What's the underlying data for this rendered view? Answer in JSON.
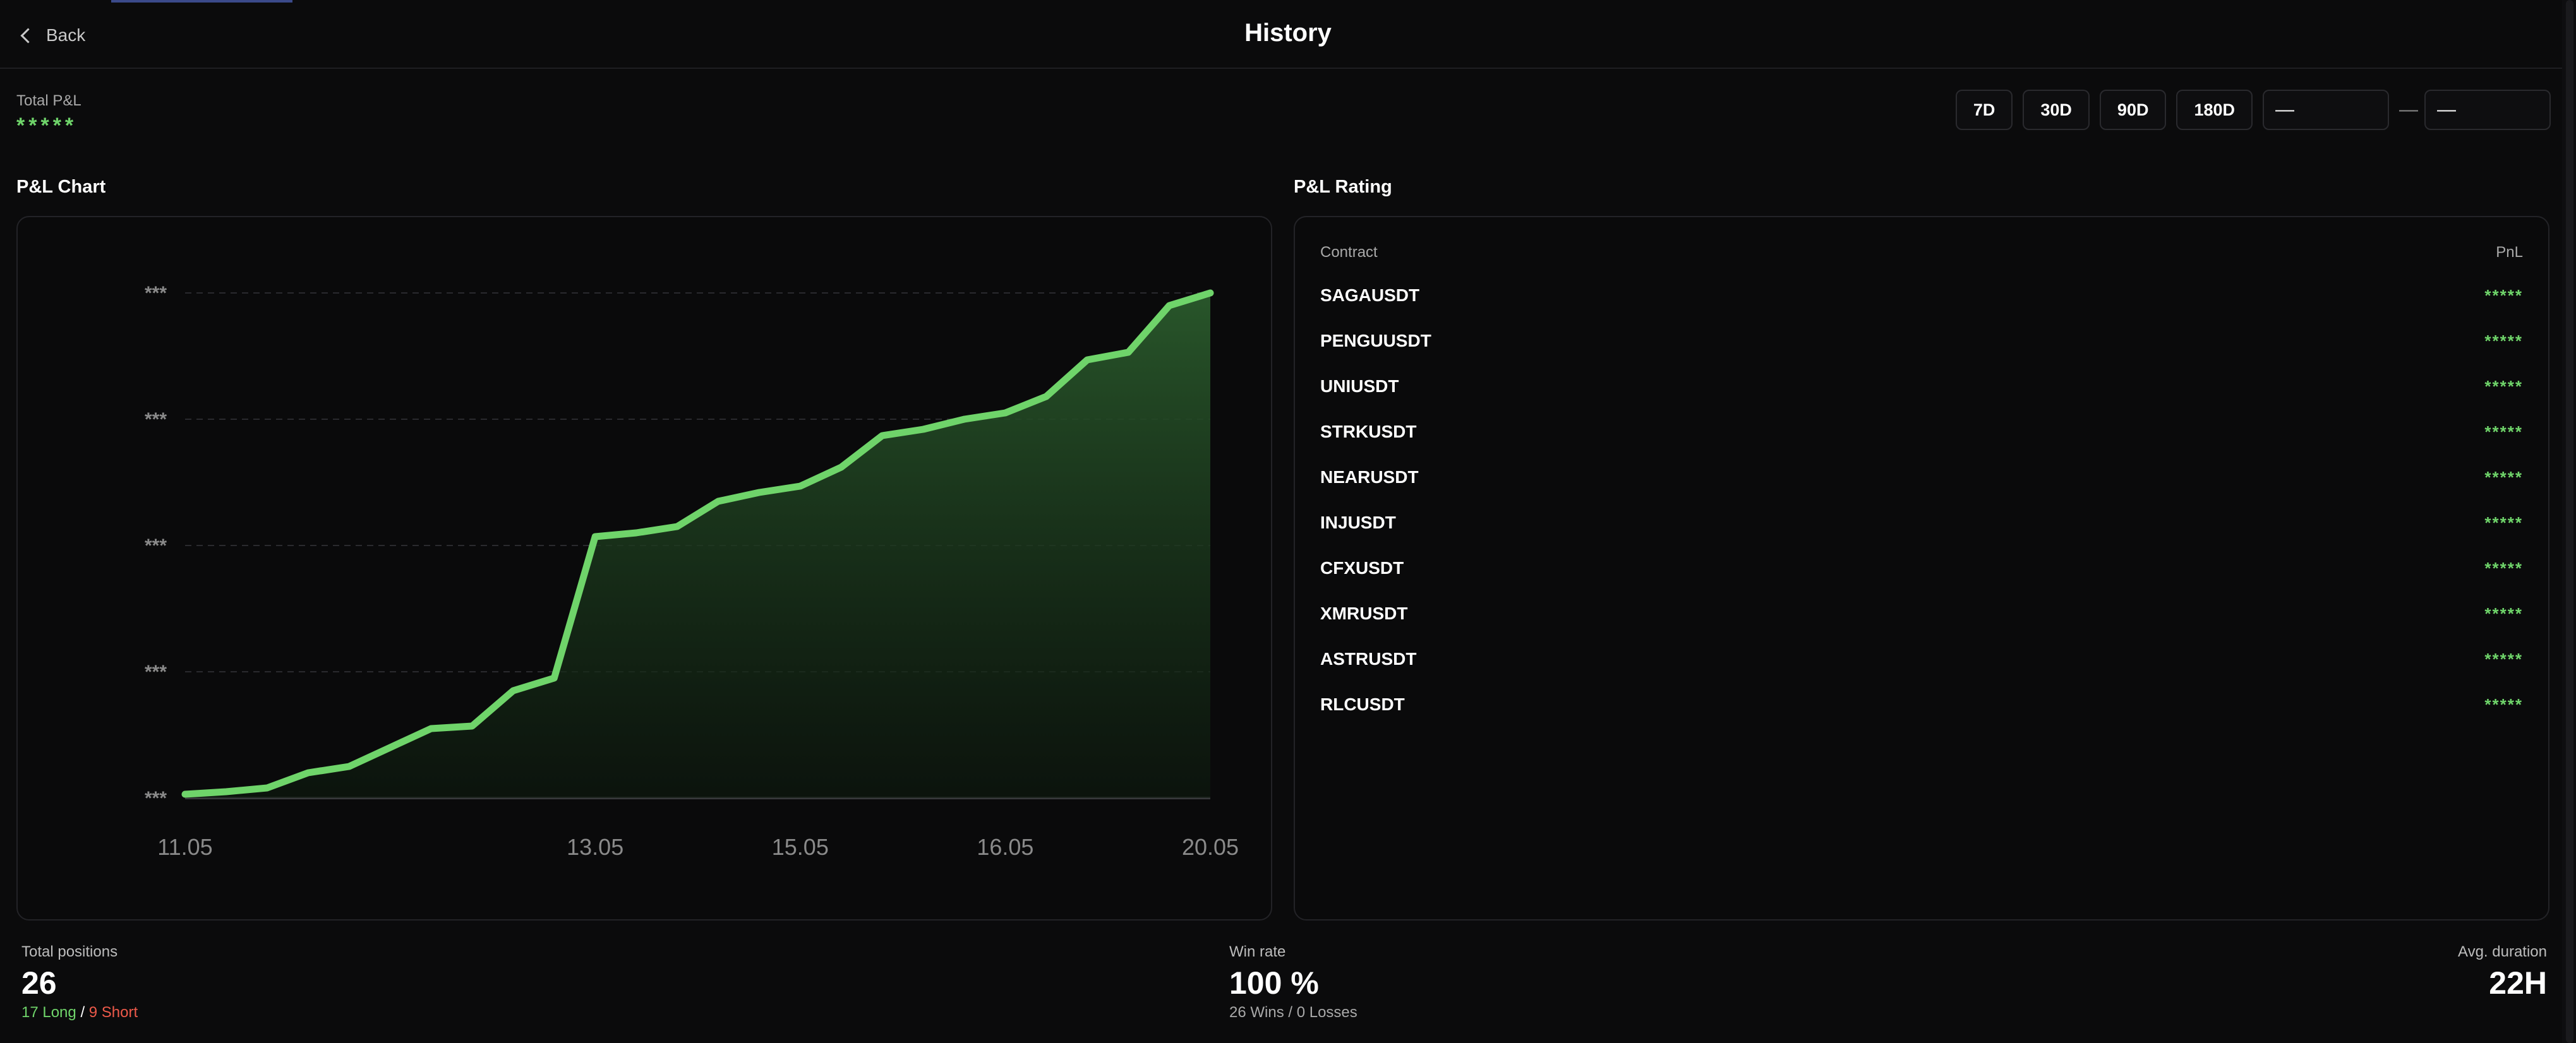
{
  "header": {
    "back_label": "Back",
    "title": "History"
  },
  "summary": {
    "total_pnl_label": "Total P&L",
    "total_pnl_value": "*****"
  },
  "filters": {
    "ranges": [
      "7D",
      "30D",
      "90D",
      "180D"
    ],
    "date_from": "—",
    "date_to": "—",
    "separator": "—"
  },
  "chart_section_title": "P&L Chart",
  "rating_section_title": "P&L Rating",
  "chart_data": {
    "type": "area",
    "title": "",
    "xlabel": "",
    "ylabel": "",
    "y_tick_labels": [
      "***",
      "***",
      "***",
      "***",
      "***"
    ],
    "x_tick_labels": [
      "11.05",
      "13.05",
      "15.05",
      "16.05",
      "20.05"
    ],
    "x_tick_positions": [
      0,
      10,
      15,
      20,
      25
    ],
    "grid": true,
    "line_color": "#6fd46a",
    "fill_color": "#1f4a22",
    "ylim": [
      0,
      4
    ],
    "series": [
      {
        "values": [
          0.03,
          0.05,
          0.08,
          0.2,
          0.25,
          0.4,
          0.55,
          0.57,
          0.85,
          0.95,
          2.07,
          2.1,
          2.15,
          2.35,
          2.42,
          2.47,
          2.62,
          2.87,
          2.92,
          3.0,
          3.05,
          3.18,
          3.47,
          3.53,
          3.9,
          4.0
        ]
      }
    ]
  },
  "rating": {
    "col_contract": "Contract",
    "col_pnl": "PnL",
    "rows": [
      {
        "symbol": "SAGAUSDT",
        "pnl": "*****"
      },
      {
        "symbol": "PENGUUSDT",
        "pnl": "*****"
      },
      {
        "symbol": "UNIUSDT",
        "pnl": "*****"
      },
      {
        "symbol": "STRKUSDT",
        "pnl": "*****"
      },
      {
        "symbol": "NEARUSDT",
        "pnl": "*****"
      },
      {
        "symbol": "INJUSDT",
        "pnl": "*****"
      },
      {
        "symbol": "CFXUSDT",
        "pnl": "*****"
      },
      {
        "symbol": "XMRUSDT",
        "pnl": "*****"
      },
      {
        "symbol": "ASTRUSDT",
        "pnl": "*****"
      },
      {
        "symbol": "RLCUSDT",
        "pnl": "*****"
      }
    ]
  },
  "stats": {
    "positions_label": "Total positions",
    "positions_value": "26",
    "long_text": "17 Long",
    "slash": "/",
    "short_text": "9 Short",
    "winrate_label": "Win rate",
    "winrate_value": "100 %",
    "winrate_sub": "26 Wins / 0 Losses",
    "duration_label": "Avg. duration",
    "duration_value": "22H"
  },
  "colors": {
    "positive": "#6fd46a",
    "negative": "#ee5a4a",
    "accent": "#3b4a8a"
  },
  "icons": {
    "back": "chevron-left-icon"
  }
}
